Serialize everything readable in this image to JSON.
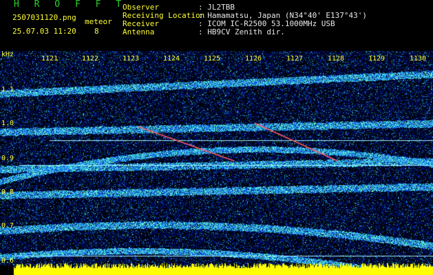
{
  "header": {
    "app_title": "H R O F F T",
    "filename": "2507031120.png",
    "mode": "meteor",
    "datetime": "25.07.03 11:20",
    "count": "8",
    "fields": [
      {
        "label": "Observer",
        "value": ": JL2TBB"
      },
      {
        "label": "Receiving Location",
        "value": ": Hamamatsu, Japan (N34°40' E137°43')"
      },
      {
        "label": "Receiver",
        "value": ": ICOM IC-R2500 53.1000MHz USB"
      },
      {
        "label": "Antenna",
        "value": ": HB9CV Zenith dir."
      }
    ]
  },
  "axes": {
    "x_ticks": [
      "1121",
      "1122",
      "1123",
      "1124",
      "1125",
      "1126",
      "1127",
      "1128",
      "1129",
      "1130"
    ],
    "y_unit": "kHz",
    "y_ticks": [
      "1.1",
      "1.0",
      "0.9",
      "0.8",
      "0.7",
      "0.6"
    ]
  },
  "colors": {
    "background": "#000000",
    "label": "#ffff33",
    "text": "#e8e8e8",
    "logo": "#2bd22b",
    "signal_bar": "#ffff00"
  }
}
